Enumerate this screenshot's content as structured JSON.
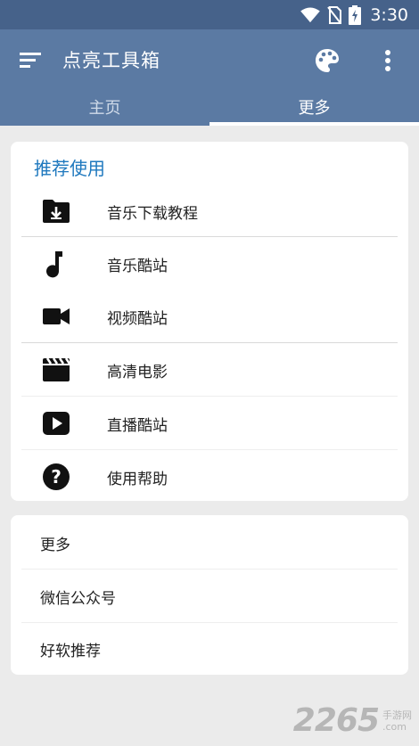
{
  "status_bar": {
    "time": "3:30",
    "icons": [
      "wifi-icon",
      "no-sim-icon",
      "battery-charging-icon"
    ]
  },
  "app_bar": {
    "title": "点亮工具箱",
    "icons": [
      "menu-icon",
      "palette-icon",
      "more-vert-icon"
    ]
  },
  "tabs": [
    {
      "label": "主页",
      "active": false
    },
    {
      "label": "更多",
      "active": true
    }
  ],
  "card_recommend": {
    "header": "推荐使用",
    "items": [
      {
        "label": "音乐下载教程",
        "icon": "download-folder-icon"
      },
      {
        "label": "音乐酷站",
        "icon": "music-note-icon"
      },
      {
        "label": "视频酷站",
        "icon": "videocam-icon"
      },
      {
        "label": "高清电影",
        "icon": "movie-clapper-icon"
      },
      {
        "label": "直播酷站",
        "icon": "play-icon"
      },
      {
        "label": "使用帮助",
        "icon": "help-icon"
      }
    ]
  },
  "card_more": {
    "items": [
      {
        "label": "更多"
      },
      {
        "label": "微信公众号"
      },
      {
        "label": "好软推荐"
      }
    ]
  },
  "watermark": {
    "number": "2265",
    "suffix": "手游网",
    "domain": ".com"
  },
  "colors": {
    "app_bar": "#5b7aa3",
    "status_bar": "#46628a",
    "accent_text": "#1e78be",
    "background": "#ebebeb"
  }
}
